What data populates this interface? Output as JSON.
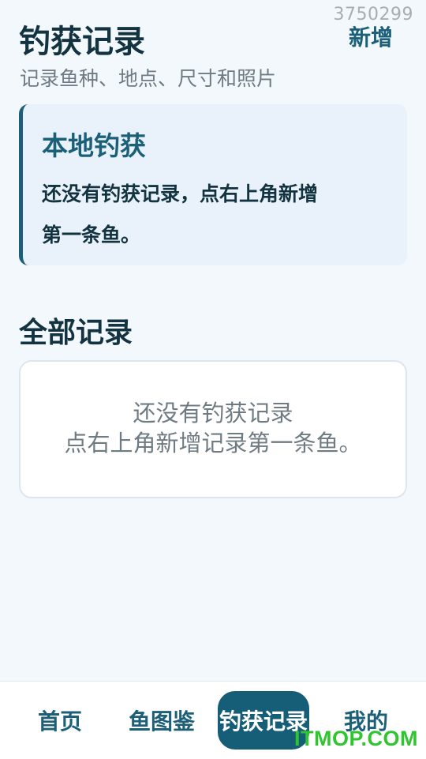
{
  "watermark_id": "3750299",
  "header": {
    "title": "钓获记录",
    "subtitle": "记录鱼种、地点、尺寸和照片",
    "add_label": "新增"
  },
  "local_card": {
    "title": "本地钓获",
    "line1": "还没有钓获记录，点右上角新增",
    "line2": "第一条鱼。"
  },
  "section": {
    "title": "全部记录"
  },
  "empty_state": {
    "line1": "还没有钓获记录",
    "line2": "点右上角新增记录第一条鱼。"
  },
  "nav": {
    "items": [
      {
        "label": "首页"
      },
      {
        "label": "鱼图鉴"
      },
      {
        "label": "钓获记录"
      },
      {
        "label": "我的"
      }
    ],
    "active_index": 2
  },
  "site_logo": "ITMOP.COM",
  "colors": {
    "accent": "#1c5f78",
    "background": "#f3f8fc",
    "card_bg": "#e9f2fa",
    "logo_green": "#2fc52f"
  }
}
